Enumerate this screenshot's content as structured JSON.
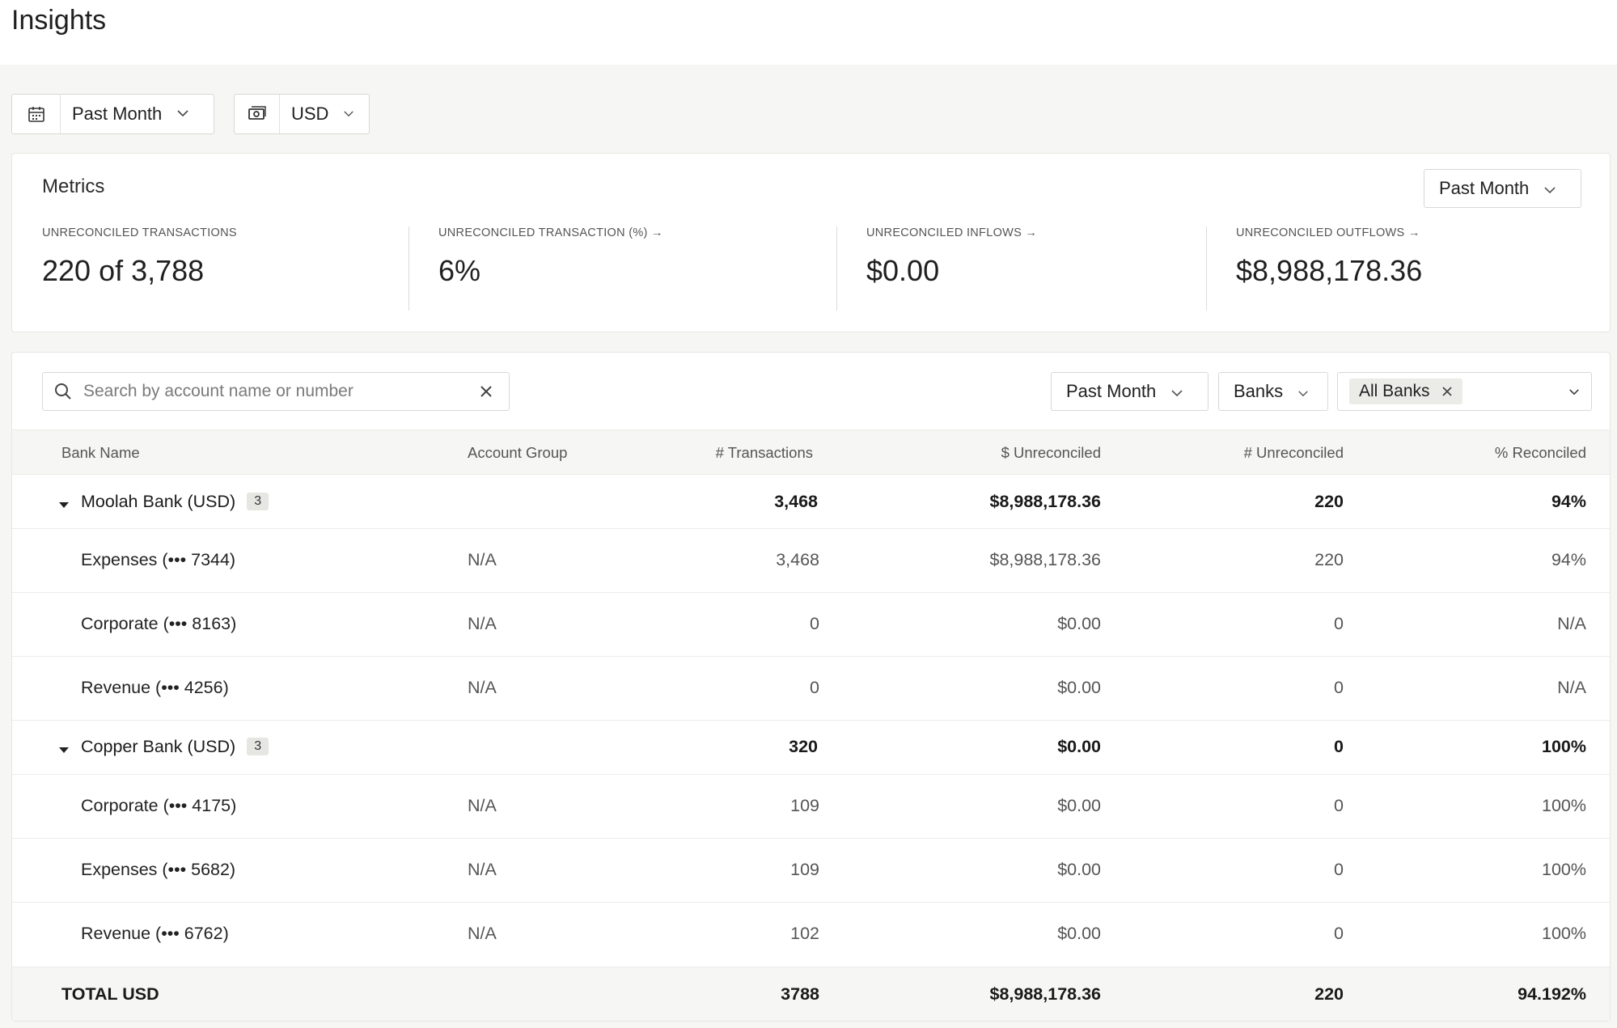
{
  "header": {
    "title": "Insights"
  },
  "filters": {
    "date_range": "Past Month",
    "currency": "USD"
  },
  "metrics": {
    "title": "Metrics",
    "period": "Past Month",
    "items": [
      {
        "label": "UNRECONCILED TRANSACTIONS",
        "value": "220 of 3,788"
      },
      {
        "label": "UNRECONCILED TRANSACTION (%) →",
        "value": "6%"
      },
      {
        "label": "UNRECONCILED INFLOWS →",
        "value": "$0.00"
      },
      {
        "label": "UNRECONCILED OUTFLOWS →",
        "value": "$8,988,178.36"
      }
    ]
  },
  "table_controls": {
    "search_placeholder": "Search by account name or number",
    "period": "Past Month",
    "grouping": "Banks",
    "bank_filter_tag": "All Banks"
  },
  "table": {
    "columns": [
      "Bank Name",
      "Account Group",
      "# Transactions",
      "$ Unreconciled",
      "# Unreconciled",
      "% Reconciled"
    ],
    "groups": [
      {
        "name": "Moolah Bank (USD)",
        "count": "3",
        "transactions": "3,468",
        "unreconciled_amount": "$8,988,178.36",
        "unreconciled_count": "220",
        "reconciled_pct": "94%",
        "accounts": [
          {
            "name": "Expenses (••• 7344)",
            "group": "N/A",
            "transactions": "3,468",
            "unreconciled_amount": "$8,988,178.36",
            "unreconciled_count": "220",
            "reconciled_pct": "94%"
          },
          {
            "name": "Corporate (••• 8163)",
            "group": "N/A",
            "transactions": "0",
            "unreconciled_amount": "$0.00",
            "unreconciled_count": "0",
            "reconciled_pct": "N/A"
          },
          {
            "name": "Revenue (••• 4256)",
            "group": "N/A",
            "transactions": "0",
            "unreconciled_amount": "$0.00",
            "unreconciled_count": "0",
            "reconciled_pct": "N/A"
          }
        ]
      },
      {
        "name": "Copper Bank (USD)",
        "count": "3",
        "transactions": "320",
        "unreconciled_amount": "$0.00",
        "unreconciled_count": "0",
        "reconciled_pct": "100%",
        "accounts": [
          {
            "name": "Corporate (••• 4175)",
            "group": "N/A",
            "transactions": "109",
            "unreconciled_amount": "$0.00",
            "unreconciled_count": "0",
            "reconciled_pct": "100%"
          },
          {
            "name": "Expenses (••• 5682)",
            "group": "N/A",
            "transactions": "109",
            "unreconciled_amount": "$0.00",
            "unreconciled_count": "0",
            "reconciled_pct": "100%"
          },
          {
            "name": "Revenue (••• 6762)",
            "group": "N/A",
            "transactions": "102",
            "unreconciled_amount": "$0.00",
            "unreconciled_count": "0",
            "reconciled_pct": "100%"
          }
        ]
      }
    ],
    "total": {
      "label": "TOTAL USD",
      "transactions": "3788",
      "unreconciled_amount": "$8,988,178.36",
      "unreconciled_count": "220",
      "reconciled_pct": "94.192%"
    }
  }
}
